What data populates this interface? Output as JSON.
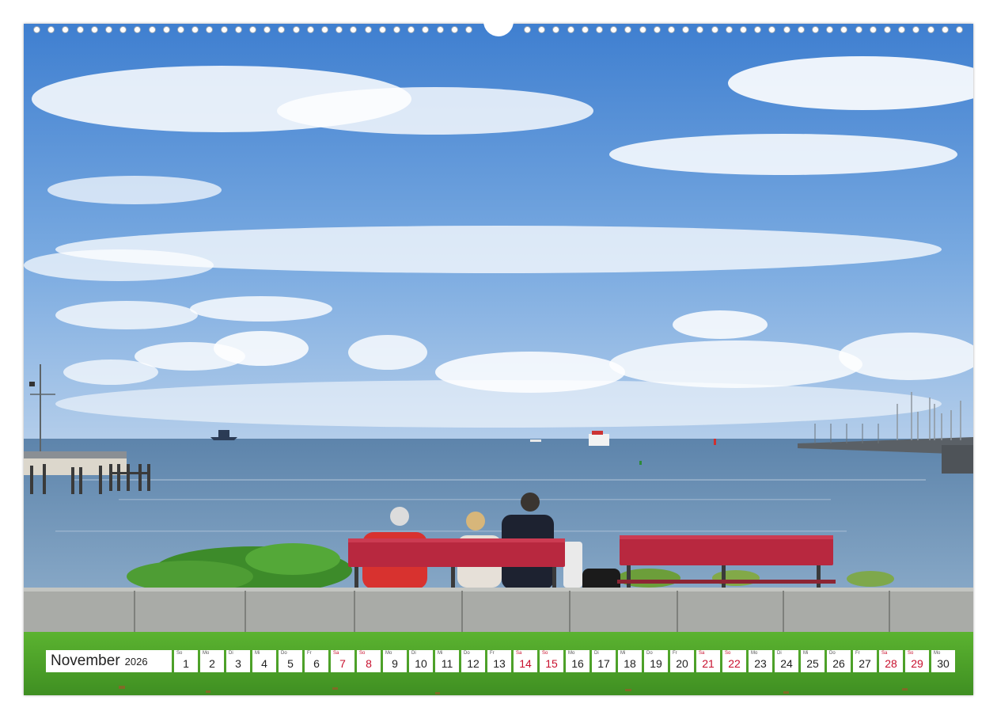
{
  "calendar": {
    "month": "November",
    "year": "2026",
    "weekend_color": "#c8102e",
    "days": [
      {
        "wd": "So",
        "d": "1",
        "weekend": false
      },
      {
        "wd": "Mo",
        "d": "2",
        "weekend": false
      },
      {
        "wd": "Di",
        "d": "3",
        "weekend": false
      },
      {
        "wd": "Mi",
        "d": "4",
        "weekend": false
      },
      {
        "wd": "Do",
        "d": "5",
        "weekend": false
      },
      {
        "wd": "Fr",
        "d": "6",
        "weekend": false
      },
      {
        "wd": "Sa",
        "d": "7",
        "weekend": true
      },
      {
        "wd": "So",
        "d": "8",
        "weekend": true
      },
      {
        "wd": "Mo",
        "d": "9",
        "weekend": false
      },
      {
        "wd": "Di",
        "d": "10",
        "weekend": false
      },
      {
        "wd": "Mi",
        "d": "11",
        "weekend": false
      },
      {
        "wd": "Do",
        "d": "12",
        "weekend": false
      },
      {
        "wd": "Fr",
        "d": "13",
        "weekend": false
      },
      {
        "wd": "Sa",
        "d": "14",
        "weekend": true
      },
      {
        "wd": "So",
        "d": "15",
        "weekend": true
      },
      {
        "wd": "Mo",
        "d": "16",
        "weekend": false
      },
      {
        "wd": "Di",
        "d": "17",
        "weekend": false
      },
      {
        "wd": "Mi",
        "d": "18",
        "weekend": false
      },
      {
        "wd": "Do",
        "d": "19",
        "weekend": false
      },
      {
        "wd": "Fr",
        "d": "20",
        "weekend": false
      },
      {
        "wd": "Sa",
        "d": "21",
        "weekend": true
      },
      {
        "wd": "So",
        "d": "22",
        "weekend": true
      },
      {
        "wd": "Mo",
        "d": "23",
        "weekend": false
      },
      {
        "wd": "Di",
        "d": "24",
        "weekend": false
      },
      {
        "wd": "Mi",
        "d": "25",
        "weekend": false
      },
      {
        "wd": "Do",
        "d": "26",
        "weekend": false
      },
      {
        "wd": "Fr",
        "d": "27",
        "weekend": false
      },
      {
        "wd": "Sa",
        "d": "28",
        "weekend": true
      },
      {
        "wd": "So",
        "d": "29",
        "weekend": true
      },
      {
        "wd": "Mo",
        "d": "30",
        "weekend": false
      }
    ]
  },
  "photo": {
    "subject": "seaside-promenade-with-red-benches",
    "colors": {
      "sky_top": "#3f7fd0",
      "sky_bottom": "#a9c8ea",
      "sea": "#6f93b5",
      "grass": "#4fa62a",
      "bench": "#b8283f"
    }
  }
}
